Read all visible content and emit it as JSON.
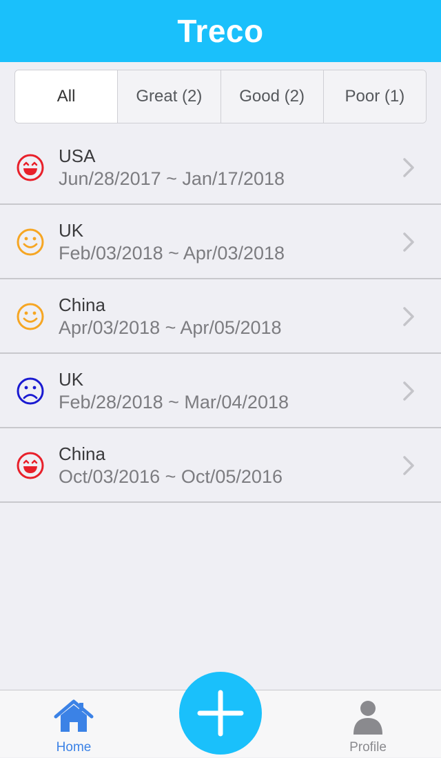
{
  "app": {
    "title": "Treco"
  },
  "filters": [
    {
      "label": "All",
      "active": true
    },
    {
      "label": "Great (2)",
      "active": false
    },
    {
      "label": "Good (2)",
      "active": false
    },
    {
      "label": "Poor (1)",
      "active": false
    }
  ],
  "trips": [
    {
      "country": "USA",
      "dates": "Jun/28/2017 ~ Jan/17/2018",
      "rating": "great",
      "icon": "laughing-face-icon",
      "color": "#e8202a"
    },
    {
      "country": "UK",
      "dates": "Feb/03/2018 ~ Apr/03/2018",
      "rating": "good",
      "icon": "smiling-face-icon",
      "color": "#f6a623"
    },
    {
      "country": "China",
      "dates": "Apr/03/2018 ~ Apr/05/2018",
      "rating": "good",
      "icon": "smiling-face-icon",
      "color": "#f6a623"
    },
    {
      "country": "UK",
      "dates": "Feb/28/2018 ~ Mar/04/2018",
      "rating": "poor",
      "icon": "sad-face-icon",
      "color": "#1a1ad1"
    },
    {
      "country": "China",
      "dates": "Oct/03/2016 ~ Oct/05/2016",
      "rating": "great",
      "icon": "laughing-face-icon",
      "color": "#e8202a"
    }
  ],
  "tabbar": {
    "home_label": "Home",
    "profile_label": "Profile",
    "add_icon": "plus-icon",
    "active_color": "#3b82e6",
    "accent_color": "#1ac0fb"
  }
}
